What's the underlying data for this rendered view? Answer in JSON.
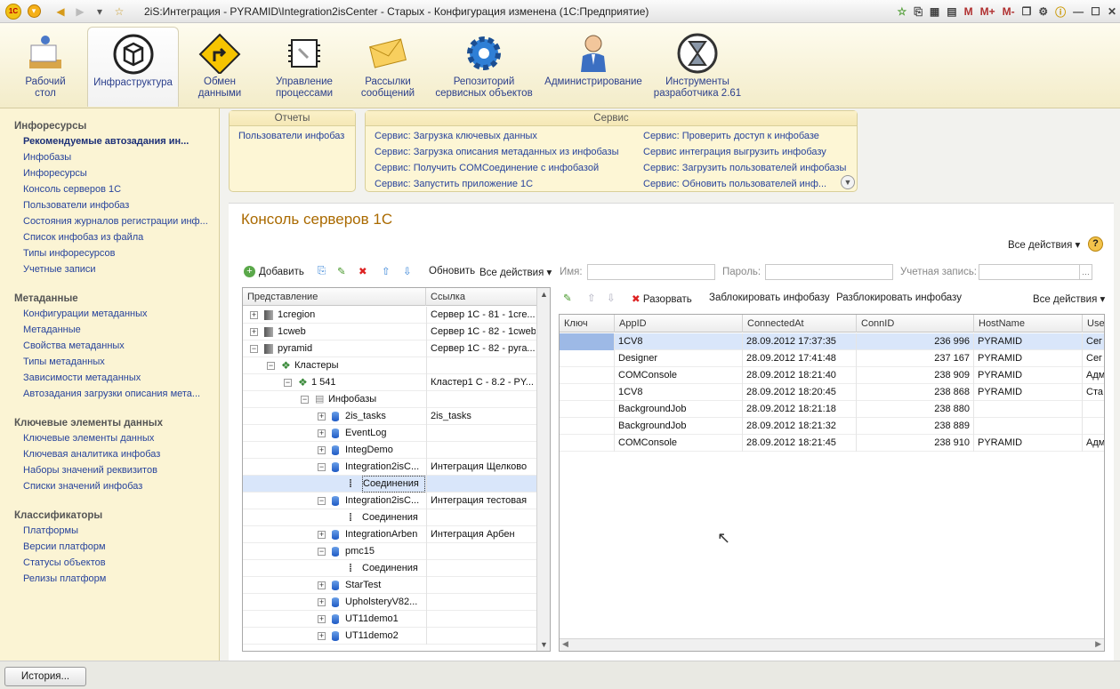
{
  "window": {
    "title": "2iS:Интеграция - PYRAMID\\Integration2isCenter - Старых - Конфигурация изменена  (1С:Предприятие)",
    "title_icons": [
      "M",
      "M+",
      "M-"
    ]
  },
  "sections": [
    {
      "id": "desktop",
      "label": "Рабочий\nстол"
    },
    {
      "id": "infra",
      "label": "Инфраструктура"
    },
    {
      "id": "exchange",
      "label": "Обмен\nданными"
    },
    {
      "id": "process",
      "label": "Управление\nпроцессами"
    },
    {
      "id": "mail",
      "label": "Рассылки\nсообщений"
    },
    {
      "id": "repo",
      "label": "Репозиторий\nсервисных объектов"
    },
    {
      "id": "admin",
      "label": "Администрирование"
    },
    {
      "id": "devtools",
      "label": "Инструменты\nразработчика 2.61"
    }
  ],
  "nav": {
    "g1": "Инфоресурсы",
    "g1_items": [
      "Рекомендуемые автозадания ин...",
      "Инфобазы",
      "Инфоресурсы",
      "Консоль серверов 1С",
      "Пользователи инфобаз",
      "Состояния журналов регистрации инф...",
      "Список инфобаз из файла",
      "Типы инфоресурсов",
      "Учетные записи"
    ],
    "g2": "Метаданные",
    "g2_items": [
      "Конфигурации метаданных",
      "Метаданные",
      "Свойства метаданных",
      "Типы метаданных",
      "Зависимости метаданных",
      "Автозадания загрузки описания мета..."
    ],
    "g3": "Ключевые элементы данных",
    "g3_items": [
      "Ключевые элементы данных",
      "Ключевая аналитика инфобаз",
      "Наборы значений реквизитов",
      "Списки значений инфобаз"
    ],
    "g4": "Классификаторы",
    "g4_items": [
      "Платформы",
      "Версии платформ",
      "Статусы объектов",
      "Релизы платформ"
    ]
  },
  "reports": {
    "title": "Отчеты",
    "items": [
      "Пользователи инфобаз"
    ]
  },
  "service": {
    "title": "Сервис",
    "col1": [
      "Сервис:  Загрузка ключевых данных",
      "Сервис:  Загрузка описания метаданных из инфобазы",
      "Сервис:  Получить COMСоединение с инфобазой",
      "Сервис: Запустить приложение 1С"
    ],
    "col2": [
      "Сервис: Проверить доступ к инфобазе",
      "Сервис интеграция выгрузить инфобазу",
      "Сервис: Загрузить пользователей инфобазы",
      "Сервис: Обновить пользователей инф..."
    ]
  },
  "form": {
    "title": "Консоль серверов 1С",
    "all_actions": "Все действия",
    "add": "Добавить",
    "refresh": "Обновить",
    "all_actions2": "Все действия",
    "name_label": "Имя:",
    "pass_label": "Пароль:",
    "acc_label": "Учетная запись:",
    "tree_headers": [
      "Представление",
      "Ссылка"
    ],
    "tree": [
      {
        "lvl": 0,
        "exp": "+",
        "ico": "srv",
        "name": "1cregion",
        "ref": "Сервер 1С - 81 - 1cre..."
      },
      {
        "lvl": 0,
        "exp": "+",
        "ico": "srv",
        "name": "1cweb",
        "ref": "Сервер 1С - 82 - 1cweb"
      },
      {
        "lvl": 0,
        "exp": "-",
        "ico": "srv",
        "name": "pyramid",
        "ref": "Сервер 1С - 82 - pyra..."
      },
      {
        "lvl": 1,
        "exp": "-",
        "ico": "cl",
        "name": "Кластеры",
        "ref": ""
      },
      {
        "lvl": 2,
        "exp": "-",
        "ico": "cl",
        "name": "1 541",
        "ref": "Кластер1 С - 8.2 - PY..."
      },
      {
        "lvl": 3,
        "exp": "-",
        "ico": "fold",
        "name": "Инфобазы",
        "ref": ""
      },
      {
        "lvl": 4,
        "exp": "+",
        "ico": "db",
        "name": "2is_tasks",
        "ref": "2is_tasks"
      },
      {
        "lvl": 4,
        "exp": "+",
        "ico": "db",
        "name": "EventLog",
        "ref": ""
      },
      {
        "lvl": 4,
        "exp": "+",
        "ico": "db",
        "name": "IntegDemo",
        "ref": ""
      },
      {
        "lvl": 4,
        "exp": "-",
        "ico": "db",
        "name": "Integration2isC...",
        "ref": "Интеграция Щелково"
      },
      {
        "lvl": 5,
        "exp": "",
        "ico": "conn",
        "name": "Соединения",
        "ref": "",
        "sel": true
      },
      {
        "lvl": 4,
        "exp": "-",
        "ico": "db",
        "name": "Integration2isC...",
        "ref": "Интеграция тестовая"
      },
      {
        "lvl": 5,
        "exp": "",
        "ico": "conn",
        "name": "Соединения",
        "ref": ""
      },
      {
        "lvl": 4,
        "exp": "+",
        "ico": "db",
        "name": "IntegrationArben",
        "ref": "Интеграция Арбен"
      },
      {
        "lvl": 4,
        "exp": "-",
        "ico": "db",
        "name": "pmc15",
        "ref": ""
      },
      {
        "lvl": 5,
        "exp": "",
        "ico": "conn",
        "name": "Соединения",
        "ref": ""
      },
      {
        "lvl": 4,
        "exp": "+",
        "ico": "db",
        "name": "StarTest",
        "ref": ""
      },
      {
        "lvl": 4,
        "exp": "+",
        "ico": "db",
        "name": "UpholsteryV82...",
        "ref": ""
      },
      {
        "lvl": 4,
        "exp": "+",
        "ico": "db",
        "name": "UT11demo1",
        "ref": ""
      },
      {
        "lvl": 4,
        "exp": "+",
        "ico": "db",
        "name": "UT11demo2",
        "ref": ""
      }
    ],
    "conn_toolbar": {
      "break": "Разорвать",
      "block": "Заблокировать инфобазу",
      "unblock": "Разблокировать инфобазу",
      "all": "Все действия"
    },
    "conn_headers": [
      "Ключ",
      "AppID",
      "ConnectedAt",
      "ConnID",
      "HostName",
      "Use"
    ],
    "conn_rows": [
      {
        "key": "",
        "app": "1CV8",
        "at": "28.09.2012 17:37:35",
        "id": "236 996",
        "host": "PYRAMID",
        "user": "Сег"
      },
      {
        "key": "",
        "app": "Designer",
        "at": "28.09.2012 17:41:48",
        "id": "237 167",
        "host": "PYRAMID",
        "user": "Сег"
      },
      {
        "key": "",
        "app": "COMConsole",
        "at": "28.09.2012 18:21:40",
        "id": "238 909",
        "host": "PYRAMID",
        "user": "Адм"
      },
      {
        "key": "",
        "app": "1CV8",
        "at": "28.09.2012 18:20:45",
        "id": "238 868",
        "host": "PYRAMID",
        "user": "Ста"
      },
      {
        "key": "",
        "app": "BackgroundJob",
        "at": "28.09.2012 18:21:18",
        "id": "238 880",
        "host": "",
        "user": ""
      },
      {
        "key": "",
        "app": "BackgroundJob",
        "at": "28.09.2012 18:21:32",
        "id": "238 889",
        "host": "",
        "user": ""
      },
      {
        "key": "",
        "app": "COMConsole",
        "at": "28.09.2012 18:21:45",
        "id": "238 910",
        "host": "PYRAMID",
        "user": "Адм"
      }
    ]
  },
  "status": {
    "history": "История..."
  }
}
